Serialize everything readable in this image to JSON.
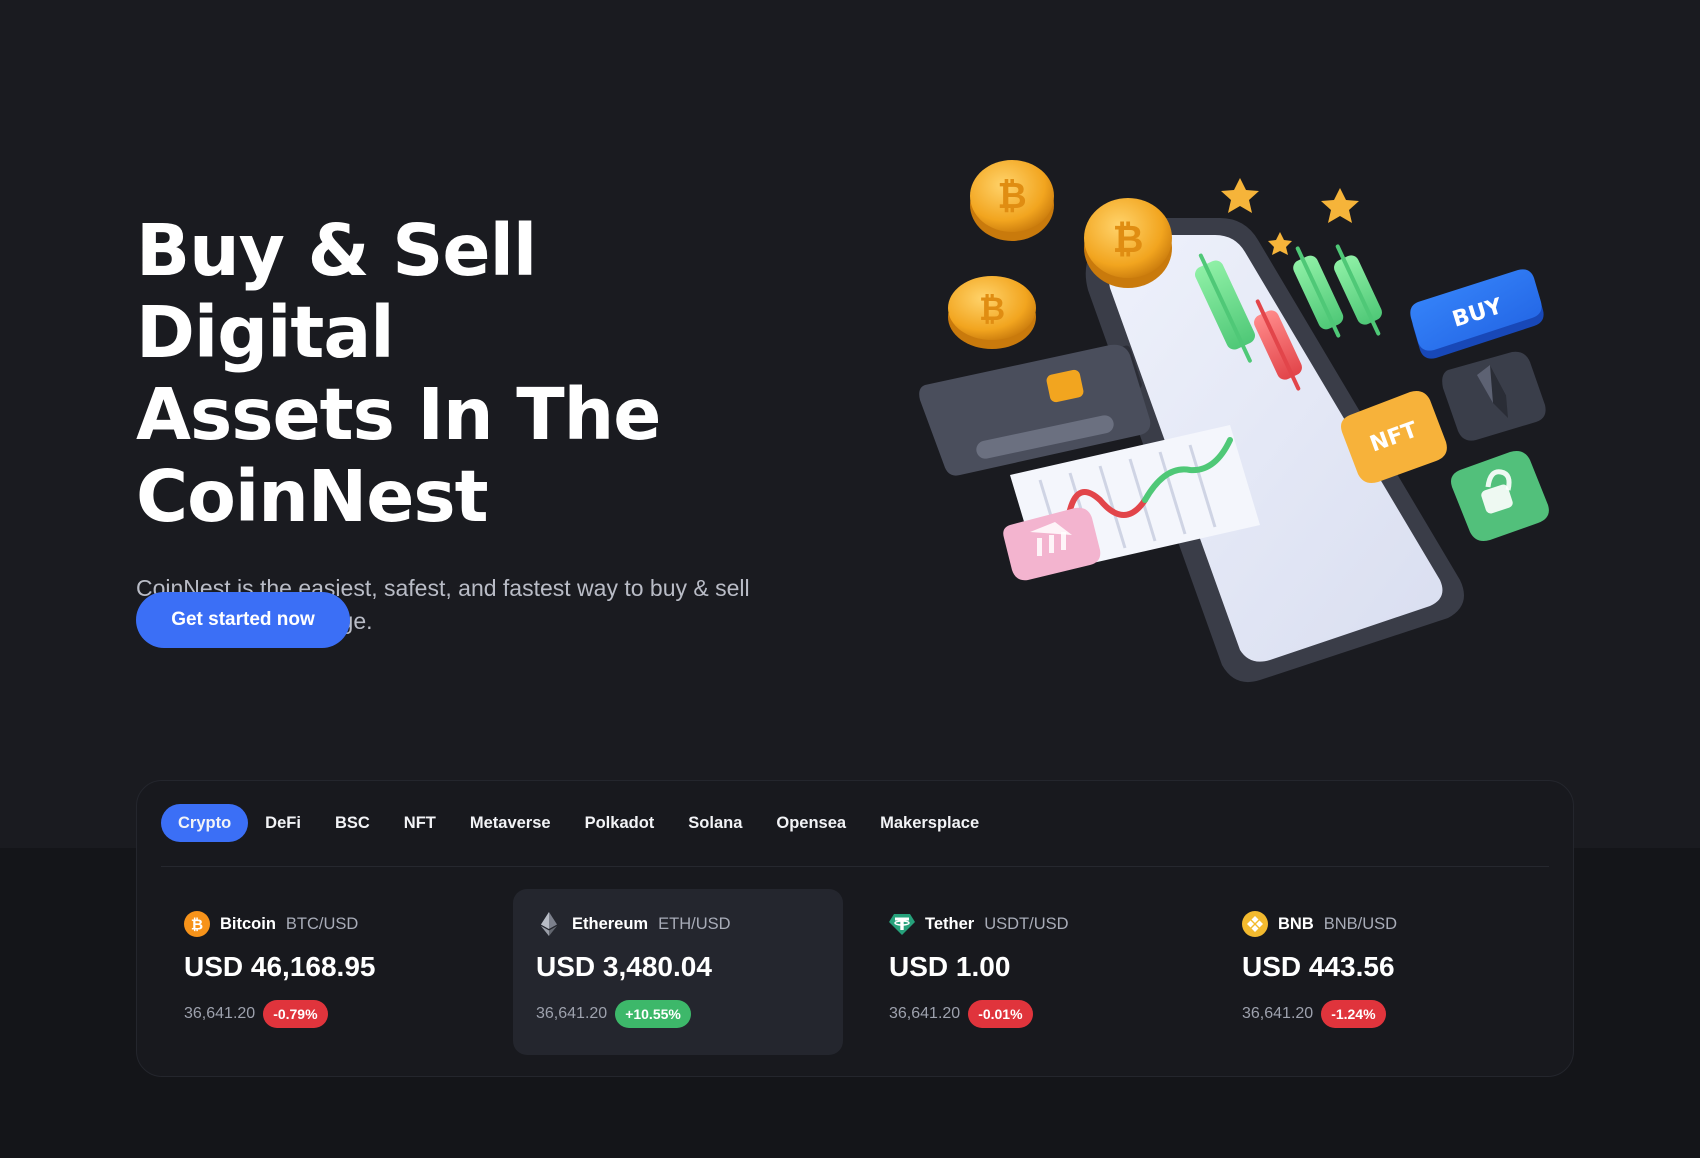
{
  "hero": {
    "title_lines": [
      "Buy & Sell Digital",
      "Assets In The",
      "CoinNest"
    ],
    "description": "CoinNest is the easiest, safest, and fastest way to buy & sell crypto asset exchange.",
    "cta_label": "Get started now",
    "illustration": {
      "buy_tile_label": "BUY",
      "nft_tile_label": "NFT",
      "icons": [
        "bitcoin-coin-icon",
        "star-icon",
        "phone-icon",
        "credit-card-icon",
        "bank-icon",
        "ethereum-icon",
        "lock-icon",
        "candlestick-chart-icon"
      ]
    }
  },
  "market": {
    "tabs": [
      {
        "label": "Crypto",
        "active": true
      },
      {
        "label": "DeFi",
        "active": false
      },
      {
        "label": "BSC",
        "active": false
      },
      {
        "label": "NFT",
        "active": false
      },
      {
        "label": "Metaverse",
        "active": false
      },
      {
        "label": "Polkadot",
        "active": false
      },
      {
        "label": "Solana",
        "active": false
      },
      {
        "label": "Opensea",
        "active": false
      },
      {
        "label": "Makersplace",
        "active": false
      }
    ],
    "coins": [
      {
        "name": "Bitcoin",
        "pair": "BTC/USD",
        "price": "USD 46,168.95",
        "volume": "36,641.20",
        "change": "-0.79%",
        "direction": "down",
        "icon": "bitcoin-icon",
        "selected": false
      },
      {
        "name": "Ethereum",
        "pair": "ETH/USD",
        "price": "USD 3,480.04",
        "volume": "36,641.20",
        "change": "+10.55%",
        "direction": "up",
        "icon": "ethereum-icon",
        "selected": true
      },
      {
        "name": "Tether",
        "pair": "USDT/USD",
        "price": "USD 1.00",
        "volume": "36,641.20",
        "change": "-0.01%",
        "direction": "down",
        "icon": "tether-icon",
        "selected": false
      },
      {
        "name": "BNB",
        "pair": "BNB/USD",
        "price": "USD 443.56",
        "volume": "36,641.20",
        "change": "-1.24%",
        "direction": "down",
        "icon": "bnb-icon",
        "selected": false
      }
    ]
  },
  "colors": {
    "accent": "#3b6ff6",
    "positive": "#3db86a",
    "negative": "#e0343c",
    "background": "#1a1b20"
  }
}
